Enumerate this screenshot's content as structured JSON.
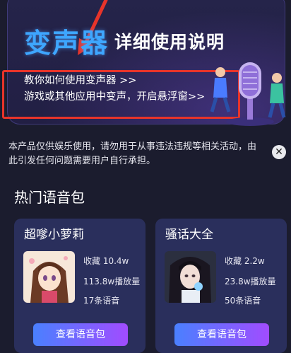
{
  "banner": {
    "brand": "变声器",
    "title": "详细使用说明",
    "link1": "教你如何使用变声器 >>",
    "link2": "游戏或其他应用中变声，开启悬浮窗>>"
  },
  "disclaimer": {
    "text": "本产品仅供娱乐使用，请勿用于从事违法违规等相关活动，由此引发任何问题需要用户自行承担。",
    "close_symbol": "✕"
  },
  "section": {
    "title": "热门语音包"
  },
  "packs": [
    {
      "name": "超嗲小萝莉",
      "favorites": "收藏 10.4w",
      "plays": "113.8w播放量",
      "count": "17条语音",
      "button": "查看语音包"
    },
    {
      "name": "骚话大全",
      "favorites": "收藏 2.2w",
      "plays": "23.8w播放量",
      "count": "50条语音",
      "button": "查看语音包"
    }
  ],
  "colors": {
    "accent": "#3ea6ff",
    "highlight": "#e8342a",
    "button_start": "#4a80ff",
    "button_end": "#a14cff"
  }
}
